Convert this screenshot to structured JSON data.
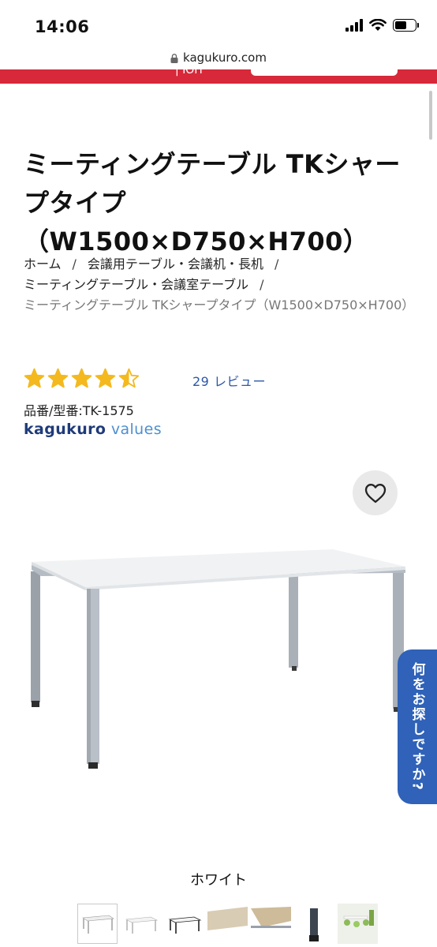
{
  "status_bar": {
    "time": "14:06"
  },
  "browser": {
    "url": "kagukuro.com"
  },
  "header": {
    "partial_text": "| ЮН"
  },
  "product": {
    "title": "ミーティングテーブル TKシャープタイプ（W1500×D750×H700）",
    "sku": "品番/型番:TK-1575",
    "rating": 4.5,
    "review_link": "29 レビュー",
    "brand_part1": "kagukuro",
    "brand_part2": " values"
  },
  "breadcrumb": {
    "items": [
      "ホーム",
      "会議用テーブル・会議机・長机",
      "ミーティングテーブル・会議室テーブル",
      "ミーティングテーブル TKシャープタイプ（W1500×D750×H700）"
    ],
    "separator": "/"
  },
  "side_tab": {
    "label": "何をお探しですか?"
  },
  "variant": {
    "label": "ホワイト"
  },
  "thumbnails": [
    "white-table",
    "white-table-2",
    "black-table",
    "wood-top",
    "wood-top-2",
    "leg-detail",
    "room-photo"
  ],
  "colors": {
    "header_red": "#d7293a",
    "link_blue": "#2b57a8",
    "star_gold": "#f4b91e",
    "side_tab_blue": "#2f62b8"
  }
}
